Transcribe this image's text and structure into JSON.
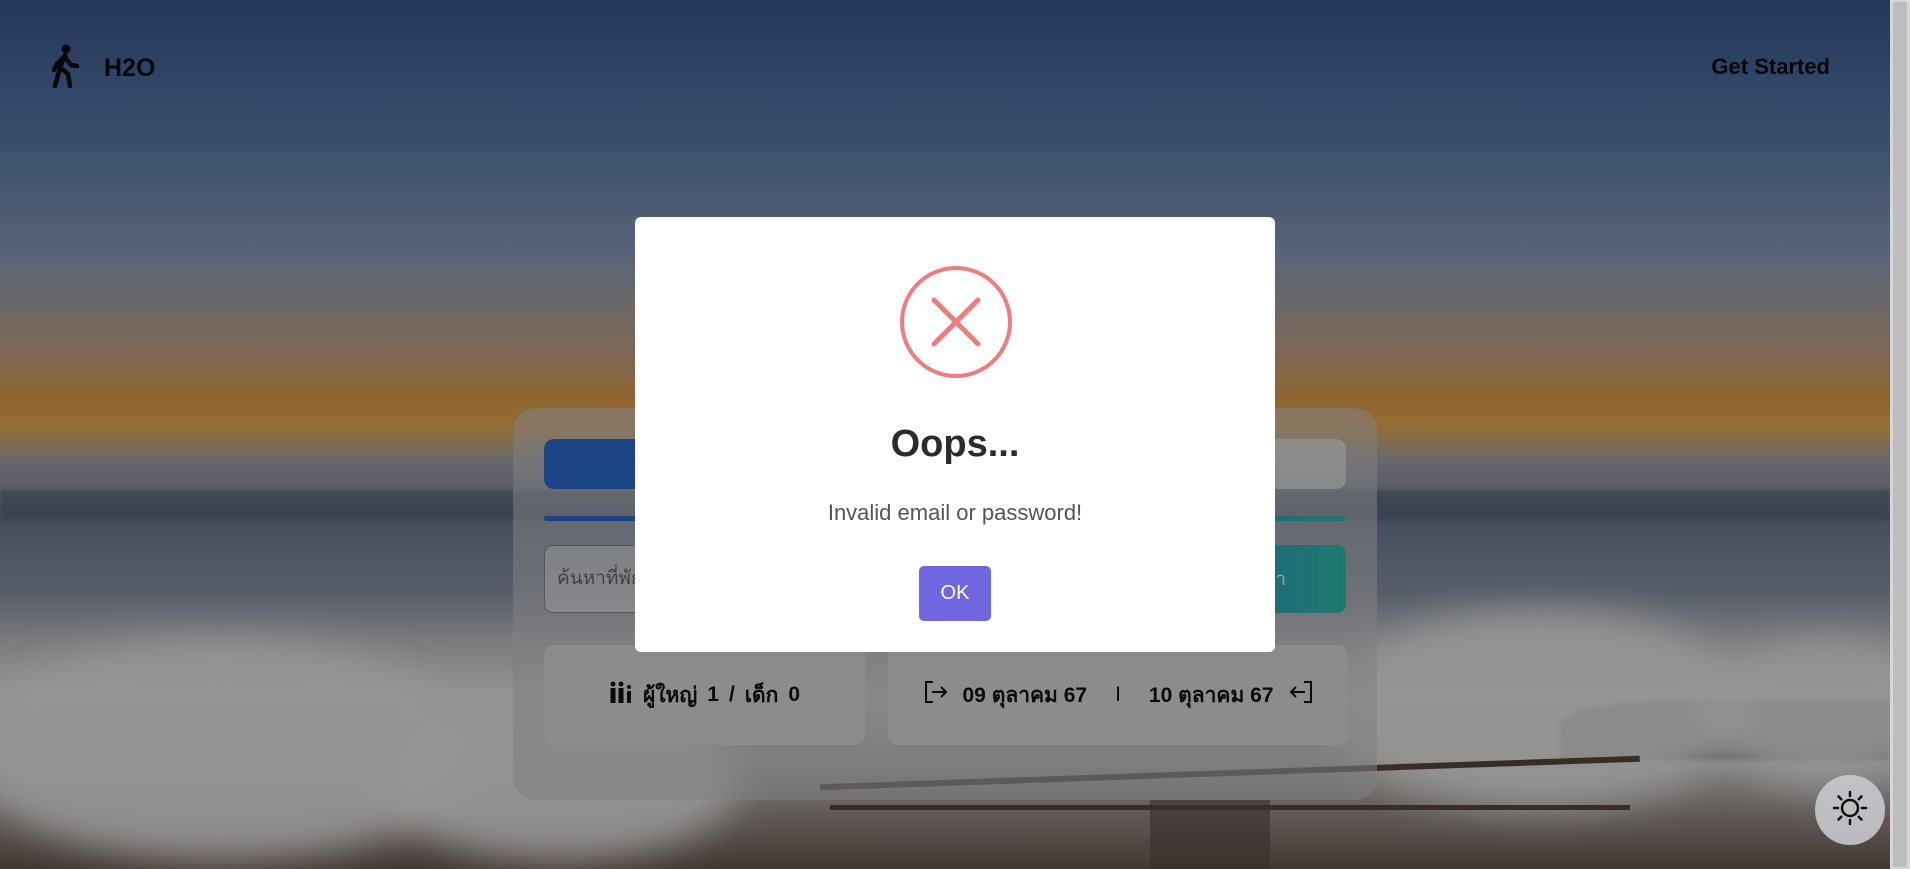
{
  "header": {
    "brand": "H2O",
    "get_started": "Get Started"
  },
  "search": {
    "placeholder": "ค้นหาที่พัก",
    "button_label": "หา"
  },
  "guests": {
    "adult_label": "ผู้ใหญ่",
    "adult_count": "1",
    "divider": "/",
    "child_label": "เด็ก",
    "child_count": "0"
  },
  "dates": {
    "checkin": "09 ตุลาคม 67",
    "divider": "I",
    "checkout": "10 ตุลาคม 67"
  },
  "modal": {
    "title": "Oops...",
    "message": "Invalid email or password!",
    "ok_label": "OK",
    "icon": "error-x-icon",
    "icon_color": "#f27474",
    "button_color": "#7066e0"
  },
  "icons": {
    "logo": "walking-person-icon",
    "guests": "family-icon",
    "checkin": "sign-out-arrow-icon",
    "checkout": "sign-in-arrow-icon",
    "theme": "sun-icon"
  }
}
